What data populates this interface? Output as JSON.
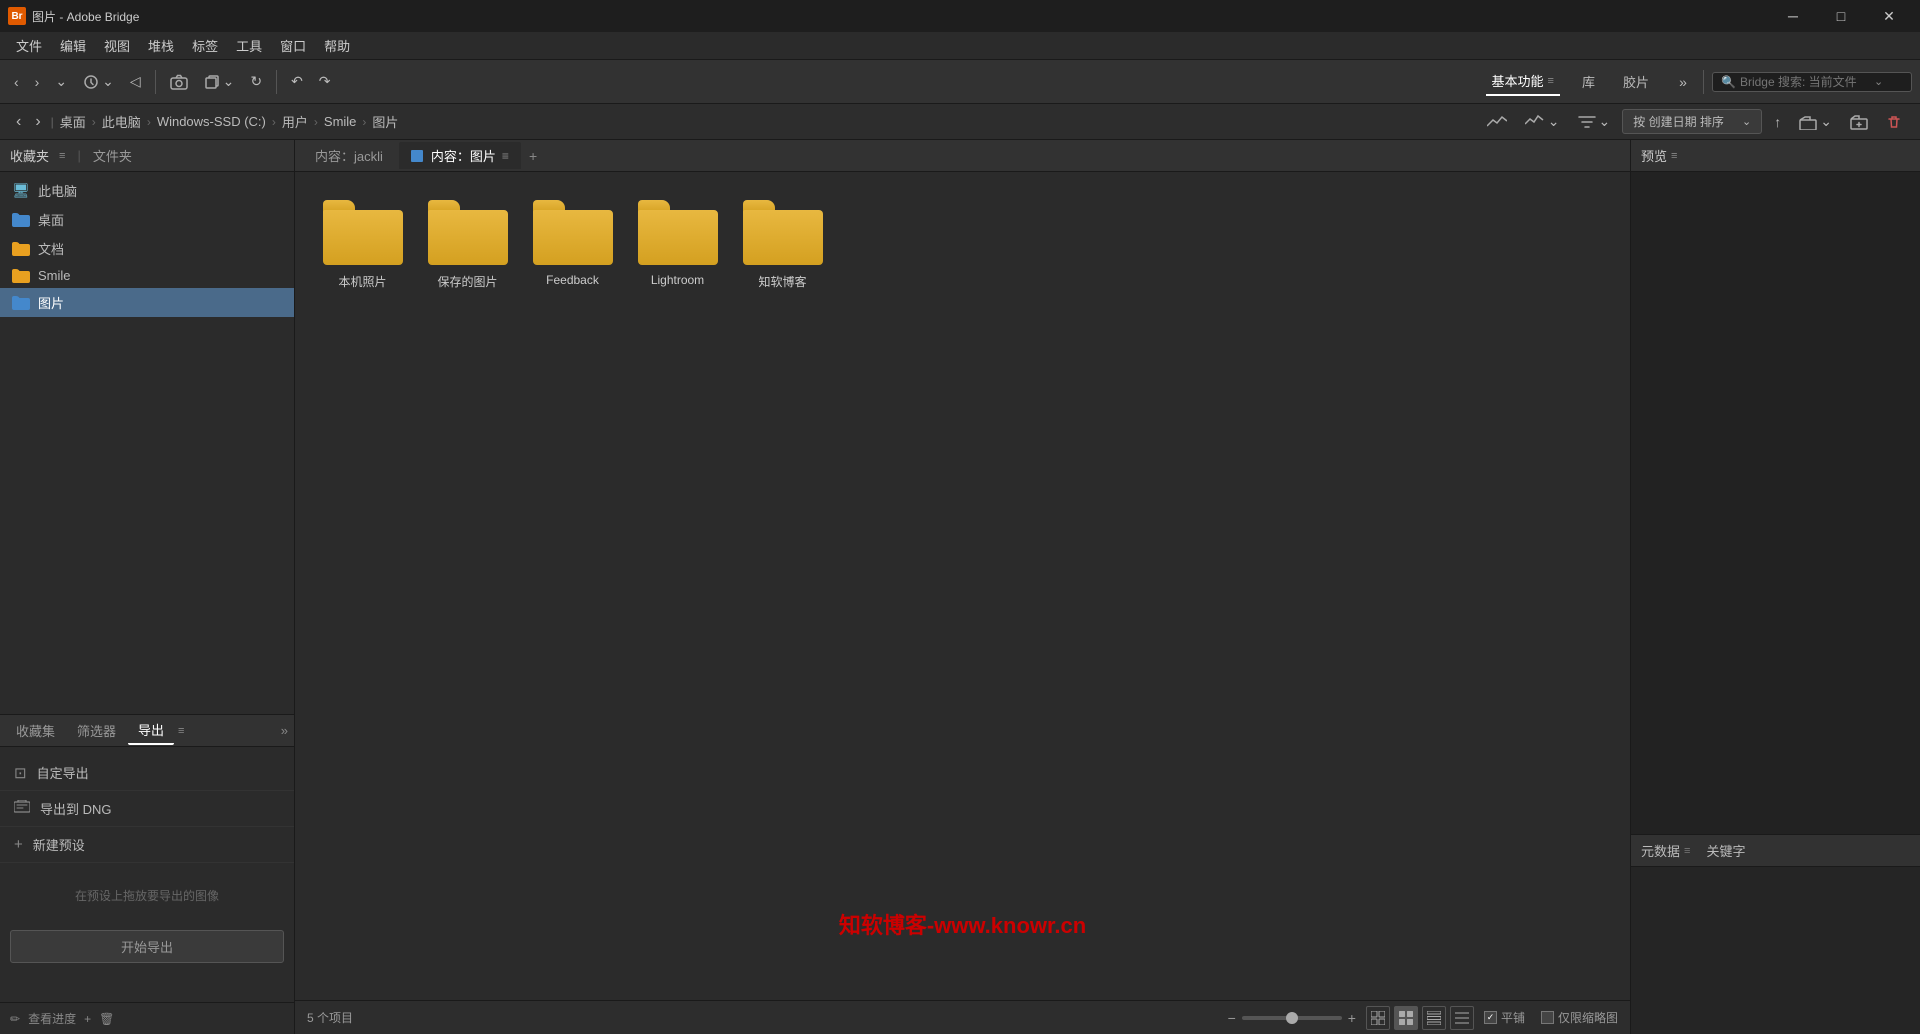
{
  "window": {
    "title": "图片 - Adobe Bridge",
    "app_icon": "Br"
  },
  "menu_bar": {
    "items": [
      "文件",
      "编辑",
      "视图",
      "堆栈",
      "标签",
      "工具",
      "窗口",
      "帮助"
    ]
  },
  "toolbar": {
    "nav_back": "‹",
    "nav_forward": "›",
    "nav_dropdown": "⌄",
    "history_icon": "⏱",
    "history_dropdown": "⌄",
    "back_icon": "◁",
    "camera_icon": "📷",
    "copy_icon": "⧉",
    "copy_dropdown": "⌄",
    "refresh_icon": "↻",
    "undo_icon": "↶",
    "redo_icon": "↷",
    "workspace_items": [
      {
        "label": "基本功能",
        "active": true,
        "has_icon": true
      },
      {
        "label": "库",
        "active": false
      },
      {
        "label": "胶片",
        "active": false
      }
    ],
    "more_icon": "»",
    "search_placeholder": "Bridge 搜索: 当前文件",
    "search_dropdown": "⌄"
  },
  "breadcrumb": {
    "items": [
      "桌面",
      "此电脑",
      "Windows-SSD (C:)",
      "用户",
      "Smile",
      "图片"
    ],
    "separators": [
      "›",
      "›",
      "›",
      "›",
      "›"
    ]
  },
  "sort": {
    "label": "按 创建日期 排序",
    "asc_icon": "↑",
    "filter_icon": "⊛",
    "filter_dropdown": "⌄",
    "folder_icon": "📁",
    "trash_icon": "🗑"
  },
  "left_panel": {
    "favorites_label": "收藏夹",
    "menu_icon": "≡",
    "folders_label": "文件夹",
    "folders": [
      {
        "name": "此电脑",
        "type": "computer"
      },
      {
        "name": "桌面",
        "type": "blue"
      },
      {
        "name": "文档",
        "type": "yellow"
      },
      {
        "name": "Smile",
        "type": "yellow"
      },
      {
        "name": "图片",
        "type": "blue",
        "active": true
      }
    ]
  },
  "bottom_panel": {
    "tabs": [
      {
        "label": "收藏集",
        "active": false
      },
      {
        "label": "筛选器",
        "active": false
      },
      {
        "label": "导出",
        "active": true
      }
    ],
    "export_items": [
      {
        "icon": "⊡",
        "label": "自定导出"
      },
      {
        "icon": "≡",
        "label": "导出到 DNG"
      },
      {
        "icon": "+",
        "label": "新建预设"
      }
    ],
    "drop_hint": "在预设上拖放要导出的图像",
    "start_export": "开始导出",
    "view_progress": "查看进度"
  },
  "content": {
    "tab_jackli": "内容：jackli",
    "tab_pictures": "内容：图片",
    "tab_add": "+",
    "tab_menu": "≡",
    "folders": [
      {
        "name": "本机照片"
      },
      {
        "name": "保存的图片"
      },
      {
        "name": "Feedback"
      },
      {
        "name": "Lightroom"
      },
      {
        "name": "知软博客"
      }
    ],
    "watermark": "知软博客-www.knowr.cn"
  },
  "right_panel": {
    "preview_label": "预览",
    "preview_menu": "≡",
    "meta_label": "元数据",
    "meta_menu": "≡",
    "keyword_label": "关键字"
  },
  "status_bar": {
    "count": "5 个项目",
    "zoom_minus": "−",
    "zoom_plus": "+",
    "view_grid": "⊞",
    "view_grid_active": "▦",
    "view_list": "▤",
    "view_details": "≡",
    "flat_label": "平铺",
    "thumb_label": "仅限缩略图"
  }
}
